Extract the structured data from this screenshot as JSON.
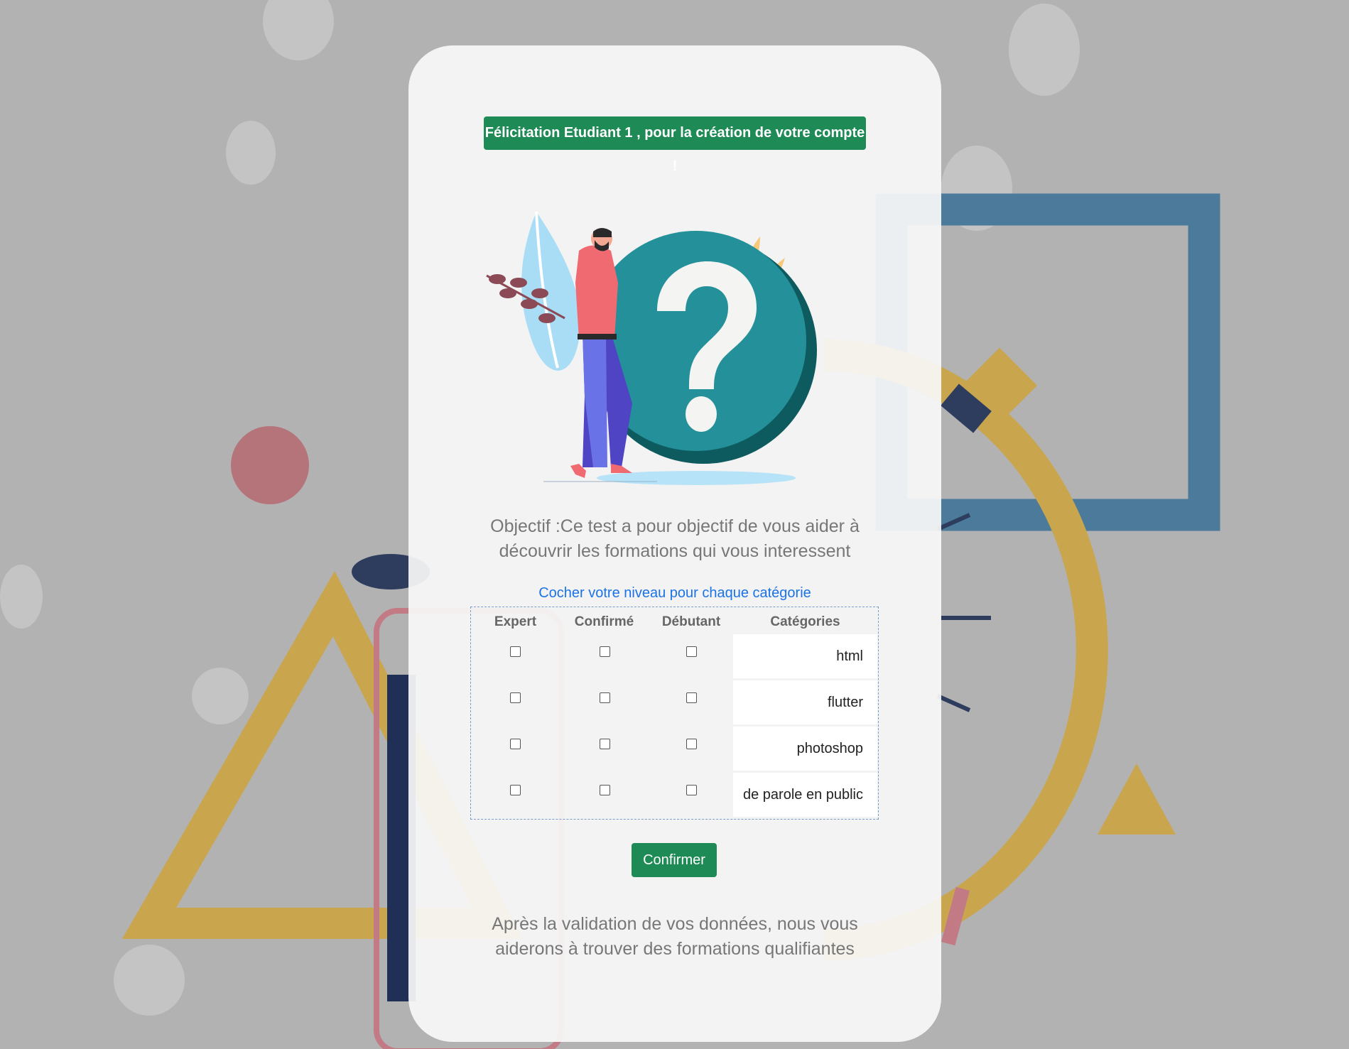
{
  "banner": {
    "text": "Félicitation Etudiant 1 , pour la création de votre compte !"
  },
  "objective": {
    "line1": "Objectif :Ce test a pour objectif de vous aider à",
    "line2": "découvrir les formations qui vous interessent"
  },
  "instruction": "Cocher votre niveau pour chaque catégorie",
  "table": {
    "headers": [
      "Expert",
      "Confirmé",
      "Débutant",
      "Catégories"
    ],
    "rows": [
      {
        "category": "html",
        "expert": false,
        "confirme": false,
        "debutant": false
      },
      {
        "category": "flutter",
        "expert": false,
        "confirme": false,
        "debutant": false
      },
      {
        "category": "photoshop",
        "expert": false,
        "confirme": false,
        "debutant": false
      },
      {
        "category": "de parole en public",
        "expert": false,
        "confirme": false,
        "debutant": false
      }
    ]
  },
  "confirm_button": {
    "label": "Confirmer"
  },
  "footer": {
    "line1": "Après la validation de vos données, nous vous",
    "line2": "aiderons à trouver des formations qualifiantes"
  },
  "colors": {
    "primary_green": "#1e8a55",
    "link_blue": "#1a73e8",
    "background": "#b2b2b2",
    "card": "#f8f8f8"
  },
  "illustration": {
    "icon": "question-mark-person-illustration"
  }
}
